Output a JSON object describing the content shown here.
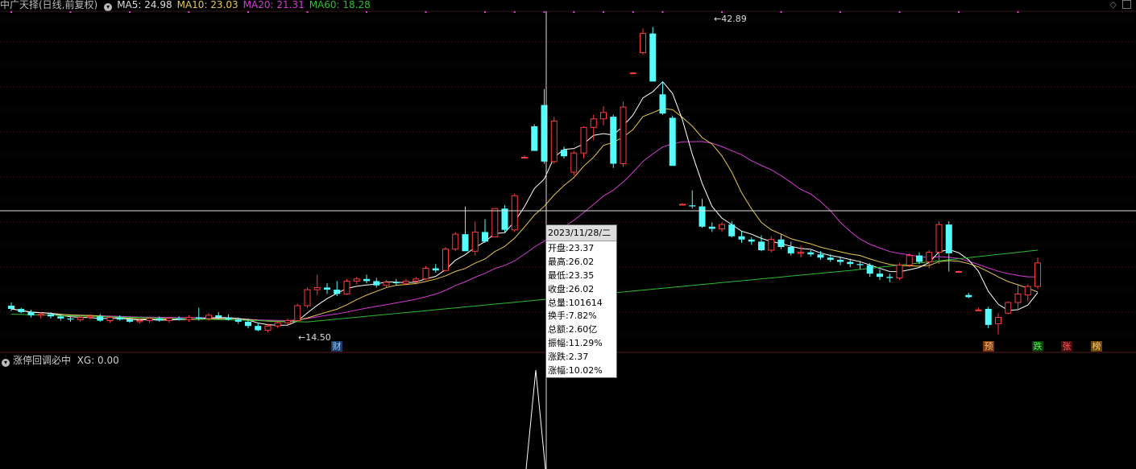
{
  "header": {
    "title": "中广天择(日线,前复权)",
    "ma5": "MA5: 24.98",
    "ma10": "MA10: 23.03",
    "ma20": "MA20: 21.31",
    "ma60": "MA60: 18.28"
  },
  "colors": {
    "up": "#ff3b3b",
    "down": "#54fcfc",
    "ma5": "#ffffff",
    "ma10": "#e6c84a",
    "ma20": "#d43ad4",
    "ma60": "#2ebd2e",
    "grid": "#2a0a0a"
  },
  "indicator": {
    "title": "涨停回调必中",
    "xg": "XG: 0.00"
  },
  "tooltip": {
    "date": "2023/11/28/二",
    "rows": [
      "开盘:23.37",
      "最高:26.02",
      "最低:23.35",
      "收盘:26.02",
      "总量:101614",
      "换手:7.82%",
      "总额:2.60亿",
      "振幅:11.29%",
      "涨跌:2.37",
      "涨幅:10.02%"
    ]
  },
  "annotations": {
    "high": "42.89",
    "low": "14.50"
  },
  "signals": [
    "财",
    "预",
    "跌",
    "张",
    "榜"
  ],
  "chart_data": {
    "type": "candlestick",
    "ylim": [
      13.0,
      44.5
    ],
    "candles": [
      [
        16.92,
        17.22,
        16.42,
        16.62
      ],
      [
        16.62,
        16.72,
        16.22,
        16.32
      ],
      [
        16.32,
        16.52,
        15.82,
        16.02
      ],
      [
        16.02,
        16.32,
        15.72,
        16.12
      ],
      [
        16.12,
        16.32,
        15.72,
        15.92
      ],
      [
        15.92,
        16.12,
        15.52,
        15.72
      ],
      [
        15.72,
        15.92,
        15.42,
        15.62
      ],
      [
        15.62,
        16.02,
        15.42,
        15.82
      ],
      [
        15.82,
        16.12,
        15.62,
        15.92
      ],
      [
        15.92,
        16.12,
        15.42,
        15.52
      ],
      [
        15.52,
        15.92,
        15.32,
        15.82
      ],
      [
        15.82,
        16.02,
        15.52,
        15.62
      ],
      [
        15.62,
        15.82,
        15.32,
        15.42
      ],
      [
        15.42,
        15.72,
        15.22,
        15.52
      ],
      [
        15.52,
        15.82,
        15.32,
        15.72
      ],
      [
        15.72,
        15.92,
        15.42,
        15.52
      ],
      [
        15.52,
        15.82,
        15.32,
        15.72
      ],
      [
        15.72,
        15.92,
        15.52,
        15.62
      ],
      [
        15.62,
        16.02,
        15.42,
        15.82
      ],
      [
        15.82,
        16.72,
        15.52,
        15.72
      ],
      [
        15.72,
        16.22,
        15.52,
        16.02
      ],
      [
        16.02,
        16.32,
        15.62,
        15.82
      ],
      [
        15.82,
        16.12,
        15.52,
        15.62
      ],
      [
        15.62,
        15.82,
        15.22,
        15.42
      ],
      [
        15.42,
        15.72,
        14.82,
        15.02
      ],
      [
        15.02,
        15.32,
        14.52,
        14.62
      ],
      [
        14.62,
        15.22,
        14.42,
        15.02
      ],
      [
        15.02,
        15.42,
        14.82,
        15.32
      ],
      [
        15.32,
        15.72,
        15.12,
        15.52
      ],
      [
        15.52,
        17.12,
        15.42,
        16.92
      ],
      [
        16.92,
        18.62,
        16.72,
        18.42
      ],
      [
        18.42,
        19.82,
        17.92,
        18.62
      ],
      [
        18.62,
        19.02,
        18.02,
        18.42
      ],
      [
        18.42,
        19.22,
        17.82,
        18.02
      ],
      [
        18.02,
        19.42,
        17.92,
        19.22
      ],
      [
        19.22,
        19.62,
        18.92,
        19.42
      ],
      [
        19.42,
        19.82,
        19.02,
        19.22
      ],
      [
        19.22,
        19.52,
        18.62,
        18.82
      ],
      [
        18.82,
        19.32,
        18.62,
        19.12
      ],
      [
        19.12,
        19.42,
        18.82,
        19.02
      ],
      [
        19.02,
        19.42,
        18.82,
        19.22
      ],
      [
        19.22,
        19.62,
        19.02,
        19.42
      ],
      [
        19.42,
        20.62,
        19.32,
        20.42
      ],
      [
        20.42,
        20.82,
        20.02,
        20.22
      ],
      [
        20.22,
        22.42,
        20.12,
        22.22
      ],
      [
        22.22,
        23.82,
        22.02,
        23.62
      ],
      [
        23.62,
        26.22,
        22.82,
        22.02
      ],
      [
        22.02,
        24.82,
        21.62,
        23.82
      ],
      [
        23.82,
        25.02,
        22.82,
        22.92
      ],
      [
        23.37,
        26.02,
        23.35,
        26.02
      ],
      [
        26.02,
        26.32,
        23.82,
        24.02
      ],
      [
        24.02,
        27.42,
        23.82,
        27.22
      ],
      [
        30.82,
        31.02,
        30.82,
        30.82
      ],
      [
        33.72,
        33.92,
        31.62,
        31.42
      ],
      [
        35.72,
        37.22,
        30.22,
        30.42
      ],
      [
        30.42,
        34.62,
        30.22,
        34.22
      ],
      [
        31.52,
        31.82,
        30.72,
        30.92
      ],
      [
        29.42,
        31.42,
        29.12,
        31.22
      ],
      [
        31.22,
        33.72,
        30.72,
        33.62
      ],
      [
        33.62,
        34.82,
        32.42,
        34.42
      ],
      [
        34.42,
        35.62,
        33.82,
        35.02
      ],
      [
        34.62,
        34.82,
        29.82,
        30.22
      ],
      [
        30.22,
        36.02,
        29.92,
        35.52
      ],
      [
        38.72,
        38.82,
        38.62,
        38.72
      ],
      [
        40.62,
        42.89,
        40.42,
        42.42
      ],
      [
        42.42,
        43.02,
        37.92,
        37.92
      ],
      [
        36.72,
        37.92,
        34.82,
        34.92
      ],
      [
        34.52,
        34.72,
        30.02,
        30.02
      ],
      [
        26.42,
        26.52,
        26.32,
        26.42
      ],
      [
        26.32,
        27.72,
        26.02,
        26.22
      ],
      [
        26.22,
        26.92,
        24.22,
        24.32
      ],
      [
        24.32,
        24.72,
        23.82,
        24.12
      ],
      [
        24.12,
        24.72,
        23.82,
        24.52
      ],
      [
        24.52,
        24.82,
        23.32,
        23.42
      ],
      [
        23.42,
        23.92,
        22.82,
        23.12
      ],
      [
        23.12,
        23.32,
        22.62,
        22.92
      ],
      [
        22.92,
        23.52,
        22.02,
        22.12
      ],
      [
        22.12,
        23.42,
        21.92,
        23.12
      ],
      [
        23.12,
        23.62,
        22.22,
        22.42
      ],
      [
        22.42,
        22.92,
        21.62,
        21.82
      ],
      [
        21.82,
        22.52,
        21.42,
        21.92
      ],
      [
        21.92,
        22.12,
        21.52,
        21.72
      ],
      [
        21.72,
        22.02,
        21.22,
        21.42
      ],
      [
        21.42,
        21.72,
        21.02,
        21.22
      ],
      [
        21.22,
        21.52,
        20.72,
        21.02
      ],
      [
        21.02,
        21.32,
        20.52,
        20.82
      ],
      [
        20.82,
        21.12,
        20.32,
        20.72
      ],
      [
        20.72,
        20.92,
        19.62,
        19.92
      ],
      [
        19.92,
        20.32,
        19.32,
        19.62
      ],
      [
        19.62,
        19.92,
        19.12,
        19.52
      ],
      [
        19.52,
        20.92,
        19.32,
        20.72
      ],
      [
        20.72,
        21.82,
        20.52,
        21.62
      ],
      [
        21.62,
        21.92,
        20.82,
        21.02
      ],
      [
        21.02,
        22.12,
        20.42,
        21.92
      ],
      [
        21.92,
        24.82,
        20.82,
        24.52
      ],
      [
        24.52,
        24.82,
        20.12,
        21.82
      ],
      [
        20.12,
        20.22,
        20.02,
        20.12
      ],
      [
        17.92,
        18.12,
        17.62,
        17.72
      ],
      [
        16.52,
        16.72,
        16.42,
        16.52
      ],
      [
        16.62,
        16.82,
        14.82,
        15.12
      ],
      [
        15.22,
        16.22,
        14.22,
        15.82
      ],
      [
        16.22,
        17.32,
        16.12,
        17.22
      ],
      [
        17.22,
        18.82,
        16.62,
        18.02
      ],
      [
        17.92,
        18.92,
        17.32,
        18.72
      ],
      [
        18.72,
        21.42,
        18.52,
        20.92
      ]
    ],
    "ma60_endpoints": [
      [
        16.12,
        17.42
      ],
      [
        20.22,
        22.22
      ]
    ]
  }
}
